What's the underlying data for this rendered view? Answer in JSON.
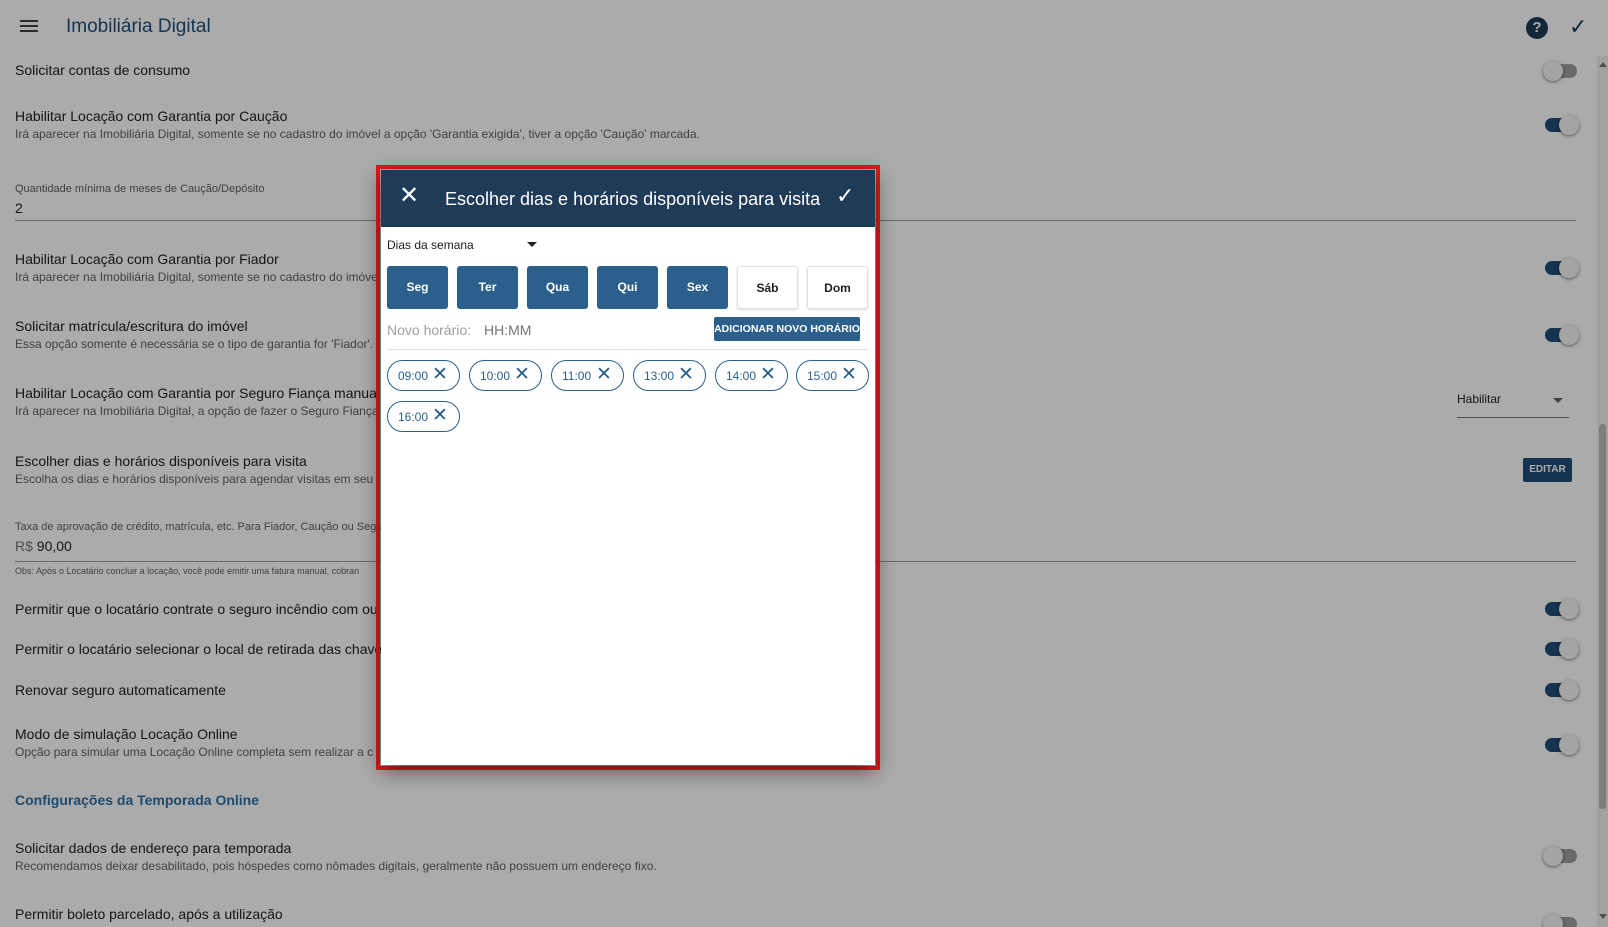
{
  "appbar": {
    "title": "Imobiliária Digital"
  },
  "settings": {
    "consumo": {
      "label": "Solicitar contas de consumo"
    },
    "caucao": {
      "label": "Habilitar Locação com Garantia por Caução",
      "sub": "Irá aparecer na Imobiliária Digital, somente se no cadastro do imóvel a opção 'Garantia exigida', tiver a opção 'Caução' marcada."
    },
    "meses": {
      "label": "Quantidade mínima de meses de Caução/Depósito",
      "value": "2"
    },
    "fiador": {
      "label": "Habilitar Locação com Garantia por Fiador",
      "sub": "Irá aparecer na Imobiliária Digital, somente se no cadastro do imóve"
    },
    "matricula": {
      "label": "Solicitar matrícula/escritura do imóvel",
      "sub": "Essa opção somente é necessária se o tipo de garantia for 'Fiador'."
    },
    "seguro_fianca": {
      "label": "Habilitar Locação com Garantia por Seguro Fiança manual",
      "sub": "Irá aparecer na Imobiliária Digital, a opção de fazer o Seguro Fiança",
      "select_value": "Habilitar"
    },
    "visita": {
      "label": "Escolher dias e horários disponíveis para visita",
      "sub": "Escolha os dias e horários disponíveis para agendar visitas em seu",
      "button": "EDITAR"
    },
    "taxa": {
      "label": "Taxa de aprovação de crédito, matrícula, etc. Para Fiador, Caução ou Seguro",
      "currency": "R$",
      "value": "90,00",
      "note": "Obs: Após o Locatário concluir a locação, você pode emitir uma fatura manual, cobran"
    },
    "seguro_incendio": {
      "label": "Permitir que o locatário contrate o seguro incêndio com ou"
    },
    "chaves": {
      "label": "Permitir o locatário selecionar o local de retirada das chave"
    },
    "renovar": {
      "label": "Renovar seguro automaticamente"
    },
    "simulacao": {
      "label": "Modo de simulação Locação Online",
      "sub": "Opção para simular uma Locação Online completa sem realizar a c"
    },
    "temporada_title": "Configurações da Temporada Online",
    "endereco": {
      "label": "Solicitar dados de endereço para temporada",
      "sub": "Recomendamos deixar desabilitado, pois hóspedes como nômades digitais, geralmente não possuem um endereço fixo."
    },
    "boleto": {
      "label": "Permitir boleto parcelado, após a utilização"
    }
  },
  "dialog": {
    "title": "Escolher dias e horários disponíveis para visita",
    "days_select_label": "Dias da semana",
    "days": [
      {
        "label": "Seg",
        "selected": true
      },
      {
        "label": "Ter",
        "selected": true
      },
      {
        "label": "Qua",
        "selected": true
      },
      {
        "label": "Qui",
        "selected": true
      },
      {
        "label": "Sex",
        "selected": true
      },
      {
        "label": "Sáb",
        "selected": false
      },
      {
        "label": "Dom",
        "selected": false
      }
    ],
    "new_time_label": "Novo horário:",
    "new_time_placeholder": "HH:MM",
    "add_button": "ADICIONAR NOVO HORÁRIO",
    "times": [
      "09:00",
      "10:00",
      "11:00",
      "13:00",
      "14:00",
      "15:00",
      "16:00"
    ]
  },
  "colors": {
    "primary": "#1f4e79",
    "dialog_header": "#1f3b57",
    "day_selected": "#2b5f8c",
    "highlight_frame": "#e11b1b"
  },
  "icons": {
    "menu": "hamburger-icon",
    "help": "help-circle-icon",
    "confirm": "check-icon",
    "close": "close-icon",
    "remove": "close-icon",
    "dropdown": "caret-down-icon"
  }
}
